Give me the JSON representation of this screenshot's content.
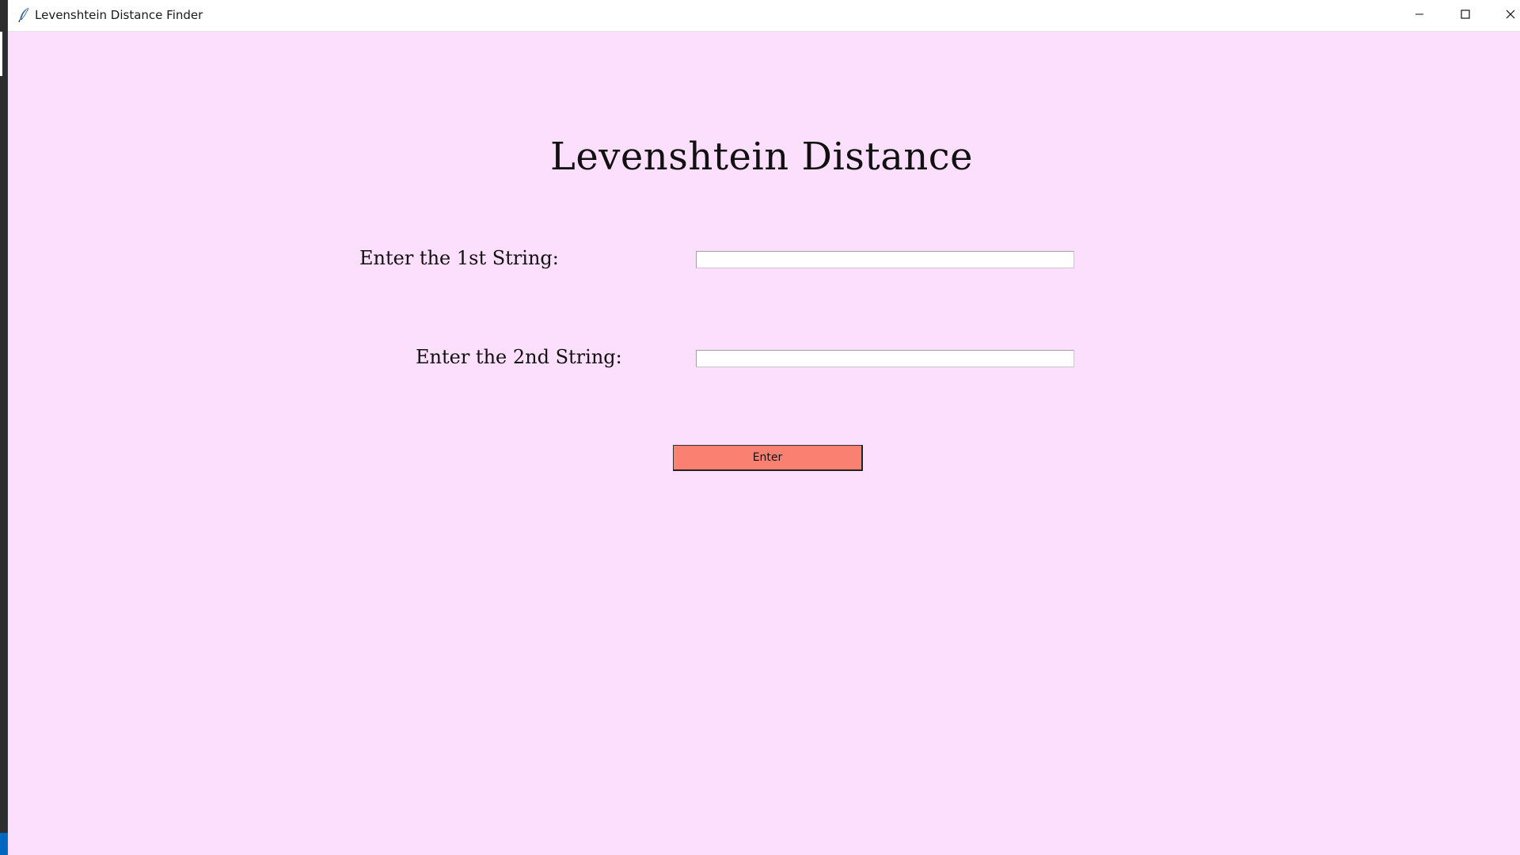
{
  "window": {
    "title": "Levenshtein Distance Finder"
  },
  "main": {
    "heading": "Levenshtein Distance",
    "first_label": "Enter the 1st String:",
    "first_value": "",
    "second_label": "Enter the 2nd String:",
    "second_value": "",
    "enter_label": "Enter"
  },
  "colors": {
    "background": "#fcdffc",
    "button": "#fa8072"
  },
  "icons": {
    "app": "feather-icon",
    "minimize": "minimize-icon",
    "maximize": "maximize-icon",
    "close": "close-icon"
  }
}
